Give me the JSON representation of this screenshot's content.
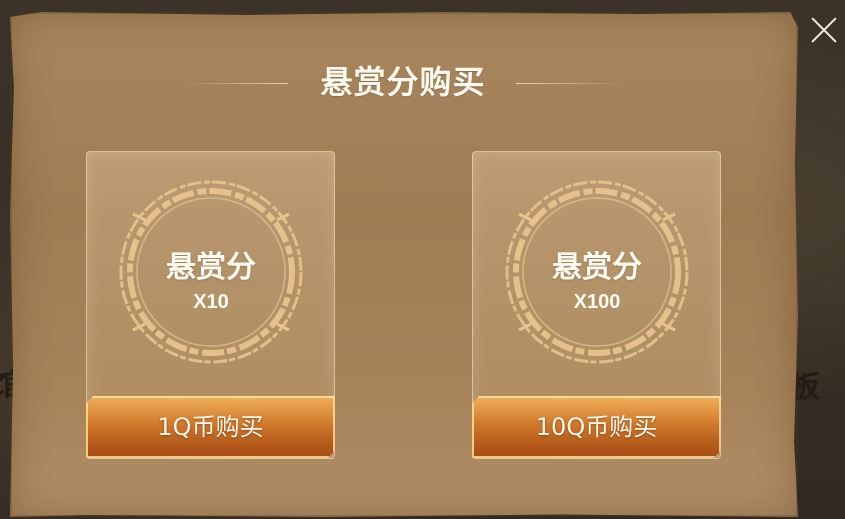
{
  "dialog": {
    "title": "悬赏分购买"
  },
  "background": {
    "left_char": "馆",
    "right_char": "板"
  },
  "colors": {
    "panel": "#a8865e",
    "button_top": "#f2b05b",
    "button_bottom": "#a24c16",
    "ring": "#e6c48f",
    "text": "#fffaf0"
  },
  "cards": [
    {
      "item_name": "悬赏分",
      "quantity": "X10",
      "buy_label": "1Q币购买"
    },
    {
      "item_name": "悬赏分",
      "quantity": "X100",
      "buy_label": "10Q币购买"
    }
  ]
}
